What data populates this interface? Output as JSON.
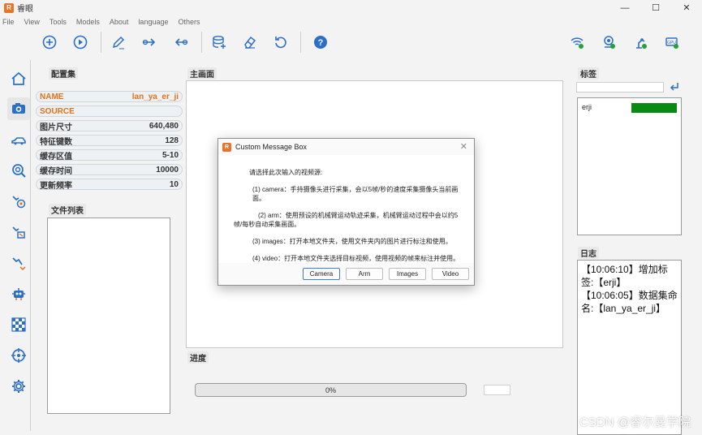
{
  "window": {
    "title": "睿眼",
    "logo_text": "R",
    "min": "—",
    "max": "☐",
    "close": "✕"
  },
  "menu": [
    "File",
    "View",
    "Tools",
    "Models",
    "About",
    "language",
    "Others"
  ],
  "toolbar": {
    "left_icons": [
      "add-icon",
      "play-icon",
      "pen-icon",
      "forward-icon",
      "back-icon",
      "database-add-icon",
      "eraser-icon",
      "refresh-icon",
      "help-icon"
    ],
    "right_icons": [
      "wifi-icon",
      "camera-status-icon",
      "robot-arm-status-icon",
      "gpu-icon"
    ],
    "gpu_label": "GPU"
  },
  "sidebar": {
    "icons": [
      "home-icon",
      "camera-icon",
      "car-icon",
      "search-zoom-icon",
      "arm-target-icon",
      "arm-grab-icon",
      "arm-move-icon",
      "robot-icon",
      "checkerboard-icon",
      "crosshair-icon",
      "settings-icon"
    ],
    "active_index": 1
  },
  "config": {
    "title": "配置集",
    "rows": [
      {
        "key": "NAME",
        "value": "lan_ya_er_ji",
        "highlight": true
      },
      {
        "key": "SOURCE",
        "value": "",
        "highlight": true
      },
      {
        "key": "图片尺寸",
        "value": "640,480",
        "highlight": false
      },
      {
        "key": "特征键数",
        "value": "128",
        "highlight": false
      },
      {
        "key": "缓存区值",
        "value": "5-10",
        "highlight": false
      },
      {
        "key": "缓存时间",
        "value": "10000",
        "highlight": false
      },
      {
        "key": "更新频率",
        "value": "10",
        "highlight": false
      }
    ]
  },
  "filelist": {
    "title": "文件列表"
  },
  "main": {
    "title": "主画面"
  },
  "progress": {
    "title": "进度",
    "value": 0,
    "text": "0%"
  },
  "tags": {
    "title": "标签",
    "items": [
      {
        "name": "erji",
        "color": "#0a8a12"
      }
    ]
  },
  "log": {
    "title": "日志",
    "lines": [
      "【10:06:10】增加标签:【erji】",
      "【10:06:05】数据集命名:【lan_ya_er_ji】"
    ]
  },
  "dialog": {
    "title": "Custom Message Box",
    "logo_text": "R",
    "intro": "请选择此次输入的视频源:",
    "lines": [
      "(1) camera：手持摄像头进行采集，会以5帧/秒的速度采集摄像头当前画面。",
      "(2) arm：使用预设的机械臂运动轨迹采集，机械臂运动过程中会以约5帧/每秒自动采集画面。",
      "(3) images：打开本地文件夹，使用文件夹内的图片进行标注和使用。",
      "(4) video：打开本地文件夹选择目标视频，使用视频的帧来标注并使用。"
    ],
    "buttons": [
      "Camera",
      "Arm",
      "Images",
      "Video"
    ]
  },
  "watermark": "CSDN @睿尔曼学院",
  "colors": {
    "accent": "#2b6fc9",
    "highlight": "#e0731c",
    "tag": "#0a8a12"
  }
}
